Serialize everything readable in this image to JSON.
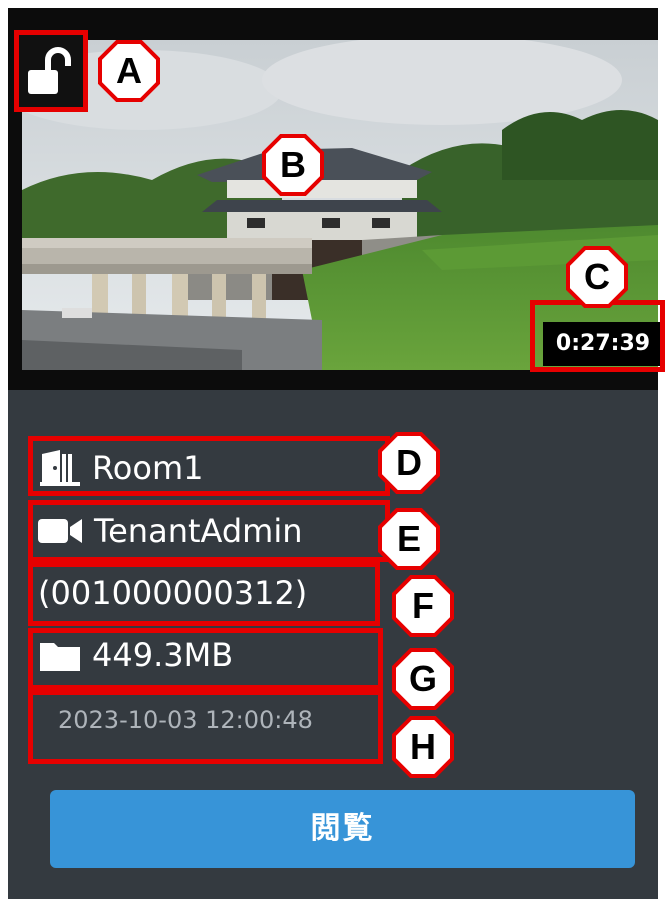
{
  "recording": {
    "duration": "0:27:39",
    "room": "Room1",
    "owner": "TenantAdmin",
    "id": "(001000000312)",
    "size": "449.3MB",
    "timestamp": "2023-10-03 12:00:48",
    "view_label": "閲覧"
  },
  "annotations": {
    "a": "A",
    "b": "B",
    "c": "C",
    "d": "D",
    "e": "E",
    "f": "F",
    "g": "G",
    "h": "H"
  },
  "icons": {
    "lock": "unlock-icon",
    "room": "door-icon",
    "owner": "video-camera-icon",
    "size": "folder-icon"
  },
  "colors": {
    "card_bg": "#343a40",
    "highlight": "#e60000",
    "button": "#3794d8",
    "muted_text": "#aeb4ba"
  }
}
